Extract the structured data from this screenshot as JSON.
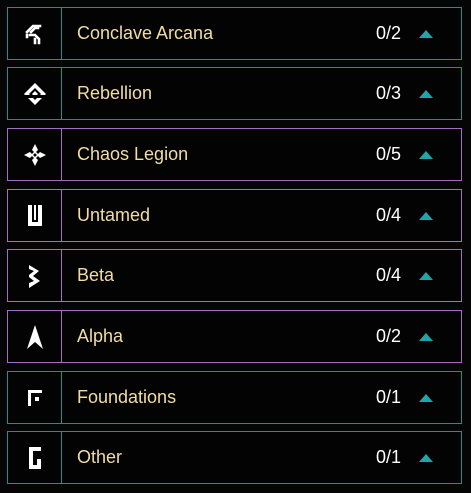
{
  "colors": {
    "teal_border": "#1f8f93",
    "purple_border": "#a46fc1",
    "name_text": "#f1dda3",
    "count_text": "#ffffff",
    "chevron": "#1fa6a8",
    "background": "#050505"
  },
  "editions": [
    {
      "name": "Conclave Arcana",
      "count": "0/2",
      "icon": "conclave-arcana-icon",
      "border": "teal"
    },
    {
      "name": "Rebellion",
      "count": "0/3",
      "icon": "rebellion-icon",
      "border": "teal"
    },
    {
      "name": "Chaos Legion",
      "count": "0/5",
      "icon": "chaos-legion-icon",
      "border": "purple"
    },
    {
      "name": "Untamed",
      "count": "0/4",
      "icon": "untamed-icon",
      "border": "purple"
    },
    {
      "name": "Beta",
      "count": "0/4",
      "icon": "beta-icon",
      "border": "purple"
    },
    {
      "name": "Alpha",
      "count": "0/2",
      "icon": "alpha-icon",
      "border": "purple"
    },
    {
      "name": "Foundations",
      "count": "0/1",
      "icon": "foundations-icon",
      "border": "teal"
    },
    {
      "name": "Other",
      "count": "0/1",
      "icon": "other-icon",
      "border": "teal"
    }
  ]
}
